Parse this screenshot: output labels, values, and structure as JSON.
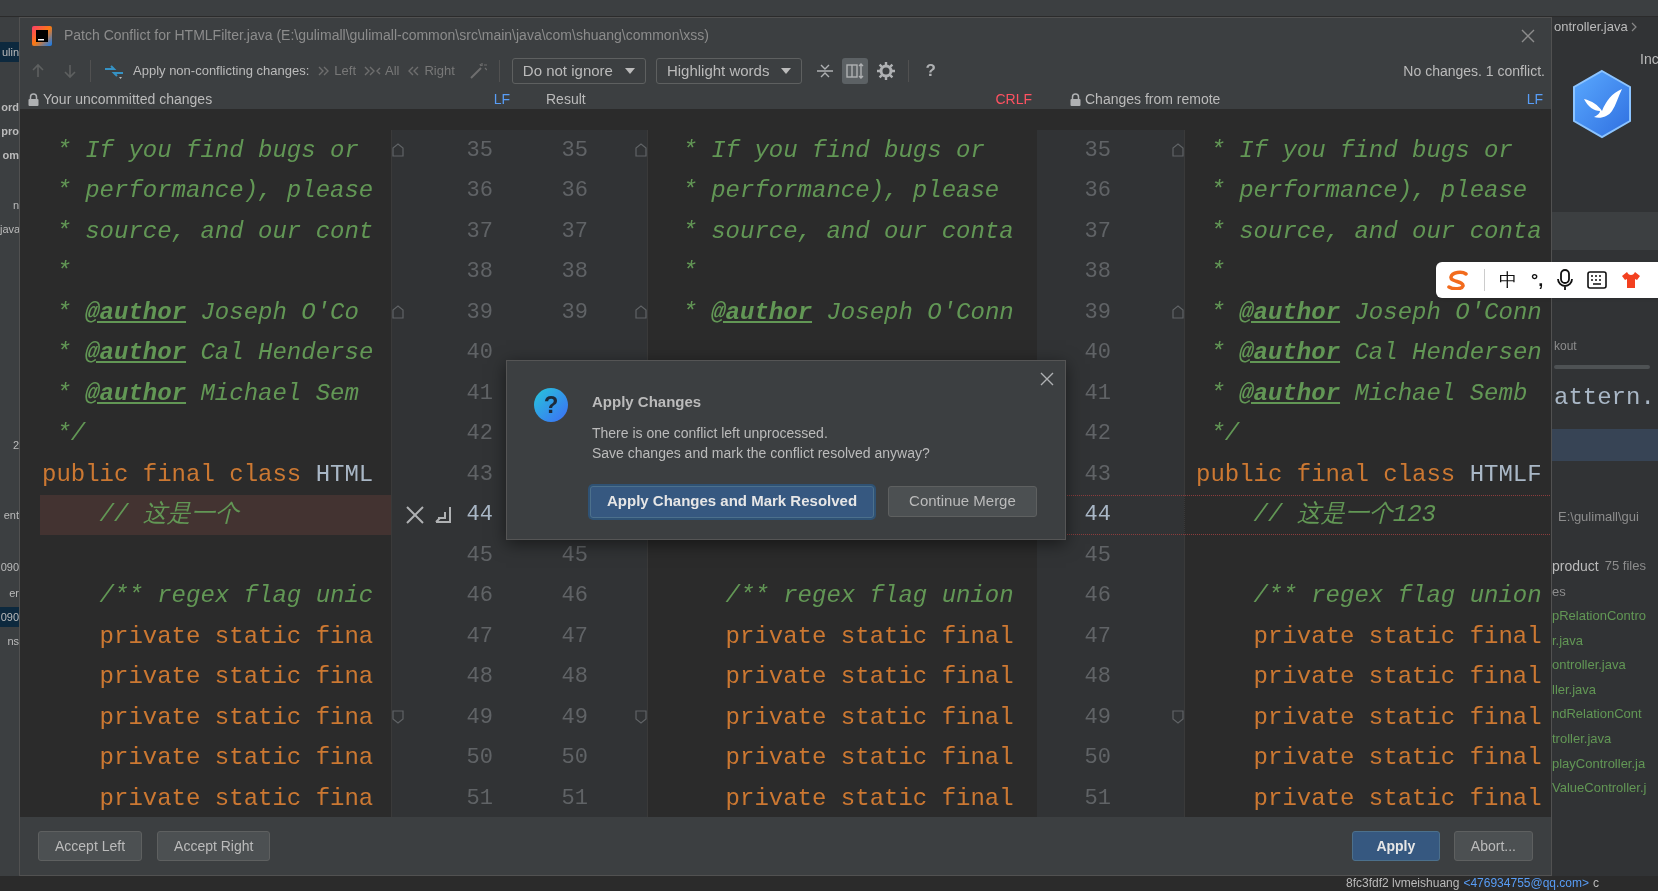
{
  "window": {
    "title": "Patch Conflict for HTMLFilter.java (E:\\gulimall\\gulimall-common\\src\\main\\java\\com\\shuang\\common\\xss)"
  },
  "toolbar": {
    "apply_label": "Apply non-conflicting changes:",
    "apply_buttons": [
      {
        "label": "Left",
        "kind": "left",
        "disabled": true
      },
      {
        "label": "All",
        "kind": "all",
        "disabled": true
      },
      {
        "label": "Right",
        "kind": "right",
        "disabled": true
      }
    ],
    "dropdowns": [
      "Do not ignore",
      "Highlight words"
    ],
    "view_toggle_selected": true,
    "help": "?",
    "status": "No changes. 1 conflict."
  },
  "panes": [
    {
      "title": "Your uncommitted changes",
      "locked": true,
      "line_separator": "LF",
      "color": "#589df6"
    },
    {
      "title": "Result",
      "locked": false,
      "line_separator": "CRLF",
      "color": "#ff5261"
    },
    {
      "title": "Changes from remote",
      "locked": true,
      "line_separator": "LF",
      "color": "#589df6"
    }
  ],
  "rows": [
    {
      "kind": "normal",
      "fold_up": true,
      "fold_down": false,
      "left_no": "35",
      "result_no": "35",
      "right_no": "35",
      "left": [
        {
          "kind": "comment",
          "text": " * If you find bugs or"
        }
      ],
      "result": [
        {
          "kind": "comment",
          "text": " * If you find bugs or"
        }
      ],
      "right": [
        {
          "kind": "comment",
          "text": " * If you find bugs or"
        }
      ]
    },
    {
      "kind": "normal",
      "fold_up": false,
      "fold_down": false,
      "left_no": "36",
      "result_no": "36",
      "right_no": "36",
      "left": [
        {
          "kind": "comment",
          "text": " * performance), please"
        }
      ],
      "result": [
        {
          "kind": "comment",
          "text": " * performance), please"
        }
      ],
      "right": [
        {
          "kind": "comment",
          "text": " * performance), please"
        }
      ]
    },
    {
      "kind": "normal",
      "fold_up": false,
      "fold_down": false,
      "left_no": "37",
      "result_no": "37",
      "right_no": "37",
      "left": [
        {
          "kind": "comment",
          "text": " * source, and our cont"
        }
      ],
      "result": [
        {
          "kind": "comment",
          "text": " * source, and our conta"
        }
      ],
      "right": [
        {
          "kind": "comment",
          "text": " * source, and our conta"
        }
      ]
    },
    {
      "kind": "normal",
      "fold_up": false,
      "fold_down": false,
      "left_no": "38",
      "result_no": "38",
      "right_no": "38",
      "left": [
        {
          "kind": "comment",
          "text": " *"
        }
      ],
      "result": [
        {
          "kind": "comment",
          "text": " *"
        }
      ],
      "right": [
        {
          "kind": "comment",
          "text": " *"
        }
      ]
    },
    {
      "kind": "normal",
      "fold_up": true,
      "fold_down": false,
      "left_no": "39",
      "result_no": "39",
      "right_no": "39",
      "left": [
        {
          "kind": "comment",
          "text": " * "
        },
        {
          "kind": "doc_tag",
          "text": "@author"
        },
        {
          "kind": "comment",
          "text": " Joseph O'Co"
        }
      ],
      "result": [
        {
          "kind": "comment",
          "text": " * "
        },
        {
          "kind": "doc_tag",
          "text": "@author"
        },
        {
          "kind": "comment",
          "text": " Joseph O'Conn"
        }
      ],
      "right": [
        {
          "kind": "comment",
          "text": " * "
        },
        {
          "kind": "doc_tag",
          "text": "@author"
        },
        {
          "kind": "comment",
          "text": " Joseph O'Conn"
        }
      ]
    },
    {
      "kind": "normal",
      "fold_up": false,
      "fold_down": false,
      "left_no": "40",
      "right_no": "40",
      "left": [
        {
          "kind": "comment",
          "text": " * "
        },
        {
          "kind": "doc_tag",
          "text": "@author"
        },
        {
          "kind": "comment",
          "text": " Cal Henderse"
        }
      ],
      "right": [
        {
          "kind": "comment",
          "text": " * "
        },
        {
          "kind": "doc_tag",
          "text": "@author"
        },
        {
          "kind": "comment",
          "text": " Cal Hendersen"
        }
      ]
    },
    {
      "kind": "normal",
      "fold_up": false,
      "fold_down": false,
      "left_no": "41",
      "right_no": "41",
      "left": [
        {
          "kind": "comment",
          "text": " * "
        },
        {
          "kind": "doc_tag",
          "text": "@author"
        },
        {
          "kind": "comment",
          "text": " Michael Sem"
        }
      ],
      "right": [
        {
          "kind": "comment",
          "text": " * "
        },
        {
          "kind": "doc_tag",
          "text": "@author"
        },
        {
          "kind": "comment",
          "text": " Michael Semb"
        }
      ]
    },
    {
      "kind": "normal",
      "fold_up": false,
      "fold_down": false,
      "left_no": "42",
      "right_no": "42",
      "left": [
        {
          "kind": "comment",
          "text": " */"
        }
      ],
      "right": [
        {
          "kind": "comment",
          "text": " */"
        }
      ]
    },
    {
      "kind": "normal",
      "fold_up": false,
      "fold_down": false,
      "left_no": "43",
      "right_no": "43",
      "left": [
        {
          "kind": "keyword",
          "text": "public final class "
        },
        {
          "kind": "plain",
          "text": "HTML"
        }
      ],
      "right": [
        {
          "kind": "keyword",
          "text": "public final class "
        },
        {
          "kind": "plain",
          "text": "HTMLF"
        }
      ]
    },
    {
      "kind": "conflict",
      "fold_up": false,
      "fold_down": false,
      "left_no": "44",
      "right_no": "44",
      "left": [
        {
          "kind": "comment",
          "text": "    // 这是一个"
        }
      ],
      "right": [
        {
          "kind": "comment",
          "text": "    // 这是一个123"
        }
      ]
    },
    {
      "kind": "normal",
      "fold_up": false,
      "fold_down": false,
      "left_no": "45",
      "result_no": "45",
      "right_no": "45"
    },
    {
      "kind": "normal",
      "fold_up": false,
      "fold_down": false,
      "left_no": "46",
      "result_no": "46",
      "right_no": "46",
      "left": [
        {
          "kind": "comment",
          "text": "    /** regex flag unic"
        }
      ],
      "result": [
        {
          "kind": "comment",
          "text": "    /** regex flag union"
        }
      ],
      "right": [
        {
          "kind": "comment",
          "text": "    /** regex flag union"
        }
      ]
    },
    {
      "kind": "normal",
      "fold_up": false,
      "fold_down": false,
      "left_no": "47",
      "result_no": "47",
      "right_no": "47",
      "left": [
        {
          "kind": "keyword",
          "text": "    private static fina"
        }
      ],
      "result": [
        {
          "kind": "keyword",
          "text": "    private static final"
        }
      ],
      "right": [
        {
          "kind": "keyword",
          "text": "    private static final"
        }
      ]
    },
    {
      "kind": "normal",
      "fold_up": false,
      "fold_down": false,
      "left_no": "48",
      "result_no": "48",
      "right_no": "48",
      "left": [
        {
          "kind": "keyword",
          "text": "    private static fina"
        }
      ],
      "result": [
        {
          "kind": "keyword",
          "text": "    private static final"
        }
      ],
      "right": [
        {
          "kind": "keyword",
          "text": "    private static final"
        }
      ]
    },
    {
      "kind": "normal",
      "fold_up": false,
      "fold_down": true,
      "left_no": "49",
      "result_no": "49",
      "right_no": "49",
      "left": [
        {
          "kind": "keyword",
          "text": "    private static fina"
        }
      ],
      "result": [
        {
          "kind": "keyword",
          "text": "    private static final"
        }
      ],
      "right": [
        {
          "kind": "keyword",
          "text": "    private static final"
        }
      ]
    },
    {
      "kind": "normal",
      "fold_up": false,
      "fold_down": false,
      "left_no": "50",
      "result_no": "50",
      "right_no": "50",
      "left": [
        {
          "kind": "keyword",
          "text": "    private static fina"
        }
      ],
      "result": [
        {
          "kind": "keyword",
          "text": "    private static final"
        }
      ],
      "right": [
        {
          "kind": "keyword",
          "text": "    private static final"
        }
      ]
    },
    {
      "kind": "normal",
      "fold_up": false,
      "fold_down": false,
      "left_no": "51",
      "result_no": "51",
      "right_no": "51",
      "left": [
        {
          "kind": "keyword",
          "text": "    private static fina"
        }
      ],
      "result": [
        {
          "kind": "keyword",
          "text": "    private static final"
        }
      ],
      "right": [
        {
          "kind": "keyword",
          "text": "    private static final"
        }
      ]
    }
  ],
  "bottom_buttons_left": [
    {
      "label": "Accept Left",
      "kind": "normal"
    },
    {
      "label": "Accept Right",
      "kind": "normal"
    }
  ],
  "bottom_buttons_right": [
    {
      "label": "Apply",
      "kind": "primary"
    },
    {
      "label": "Abort...",
      "kind": "normal"
    }
  ],
  "dialog": {
    "title": "Apply Changes",
    "icon": "?",
    "message": [
      "There is one conflict left unprocessed.",
      "Save changes and mark the conflict resolved anyway?"
    ],
    "buttons": [
      {
        "label": "Apply Changes and Mark Resolved",
        "kind": "primary"
      },
      {
        "label": "Continue Merge",
        "kind": "normal"
      }
    ]
  },
  "background": {
    "left_items": [
      {
        "text": "ulin",
        "selected": true,
        "bold": false
      },
      {
        "text": "ord",
        "selected": false,
        "bold": true
      },
      {
        "text": "pro",
        "selected": false,
        "bold": true
      },
      {
        "text": "om",
        "selected": false,
        "bold": true
      },
      {
        "text": "n",
        "selected": false,
        "bold": false
      },
      {
        "text": "java",
        "selected": false,
        "bold": false
      },
      {
        "text": "2",
        "selected": false,
        "bold": false
      },
      {
        "text": "ent",
        "selected": false,
        "bold": false
      },
      {
        "text": "090",
        "selected": false,
        "bold": false
      },
      {
        "text": "er",
        "selected": false,
        "bold": false
      },
      {
        "text": "090",
        "selected": true,
        "bold": false
      },
      {
        "text": "ns",
        "selected": false,
        "bold": false
      }
    ],
    "tab": "ontroller.java",
    "side_label": "Inc",
    "section_label": "kout",
    "code_fragment": "attern.",
    "path": "E:\\gulimall\\gui",
    "module": "product",
    "file_count": "75 files",
    "group_label": "es",
    "files": [
      "pRelationContro",
      "r.java",
      "ontroller.java",
      "ller.java",
      "ndRelationCont",
      "troller.java",
      "playController.ja",
      "ValueController.j"
    ],
    "status": {
      "commit": "8fc3fdf2 lvmeishuang",
      "email": "<476934755@qq.com>",
      "tail": "c"
    }
  },
  "ime_toolbar": {
    "items": [
      "中",
      "°,"
    ]
  }
}
